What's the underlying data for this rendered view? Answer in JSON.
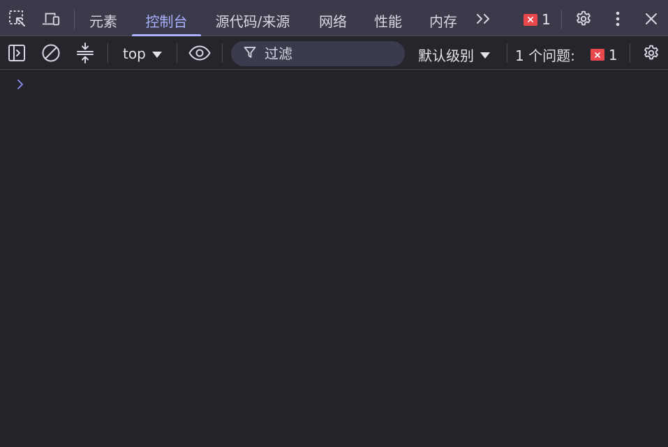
{
  "tabbar": {
    "inspect_icon": "inspect-element-icon",
    "device_icon": "device-toolbar-icon",
    "tabs": [
      {
        "label": "元素"
      },
      {
        "label": "控制台",
        "active": true
      },
      {
        "label": "源代码/来源"
      },
      {
        "label": "网络"
      },
      {
        "label": "性能"
      },
      {
        "label": "内存"
      }
    ],
    "more_tabs_icon": "chevron-double-right-icon",
    "error_count": "1",
    "settings_icon": "gear-icon",
    "menu_icon": "kebab-menu-icon",
    "close_icon": "close-icon"
  },
  "toolbar": {
    "sidebar_icon": "sidebar-toggle-icon",
    "clear_icon": "clear-console-icon",
    "collapse_icon": "collapse-icon",
    "context": "top",
    "eye_icon": "eye-icon",
    "filter_icon": "filter-icon",
    "filter_placeholder": "过滤",
    "levels_label": "默认级别",
    "issues_label": "1 个问题:",
    "issues_count": "1",
    "settings_icon": "gear-icon"
  },
  "console": {
    "prompt_icon": "chevron-right-icon",
    "input_value": ""
  },
  "colors": {
    "tabbar_bg": "#3a3a4b",
    "console_bg": "#242329",
    "accent": "#a9b0ff",
    "error": "#e8474b",
    "prompt": "#8c93f0"
  }
}
